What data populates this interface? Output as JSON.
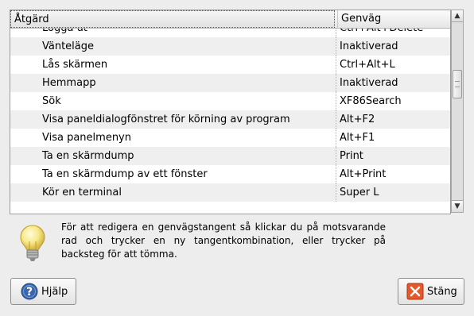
{
  "columns": {
    "action": "Åtgärd",
    "shortcut": "Genväg"
  },
  "rows": [
    {
      "action": "Logga ut",
      "shortcut": "Ctrl+Alt+Delete"
    },
    {
      "action": "Vänteläge",
      "shortcut": "Inaktiverad"
    },
    {
      "action": "Lås skärmen",
      "shortcut": "Ctrl+Alt+L"
    },
    {
      "action": "Hemmapp",
      "shortcut": "Inaktiverad"
    },
    {
      "action": "Sök",
      "shortcut": "XF86Search"
    },
    {
      "action": "Visa paneldialogfönstret för körning av program",
      "shortcut": "Alt+F2"
    },
    {
      "action": "Visa panelmenyn",
      "shortcut": "Alt+F1"
    },
    {
      "action": "Ta en skärmdump",
      "shortcut": "Print"
    },
    {
      "action": "Ta en skärmdump av ett fönster",
      "shortcut": "Alt+Print"
    },
    {
      "action": "Kör en terminal",
      "shortcut": "Super L"
    }
  ],
  "hint_text": "För att redigera en genvägstangent så klickar du på motsvarande rad och trycker en ny tangentkombination, eller trycker på backsteg för att tömma.",
  "buttons": {
    "help": "Hjälp",
    "close": "Stäng"
  },
  "icons": {
    "hint": "lightbulb-icon",
    "help": "help-icon",
    "close": "close-icon"
  },
  "colors": {
    "close_icon": "#e8572a",
    "help_icon": "#3a66b0",
    "bulb": "#f2e27a"
  }
}
